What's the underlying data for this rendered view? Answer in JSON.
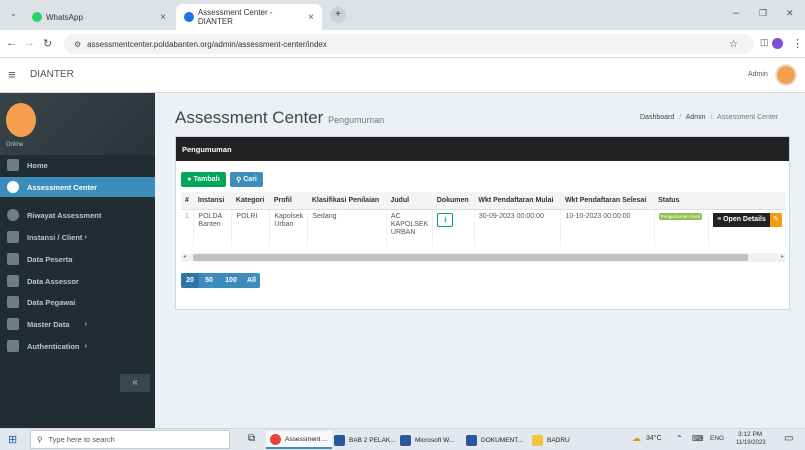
{
  "browser": {
    "tabs": [
      {
        "label": "WhatsApp",
        "active": false
      },
      {
        "label": "Assessment Center - DIANTER",
        "active": true
      }
    ],
    "new_tab": "+",
    "url_scheme_icon": "site-info-icon",
    "url": "assessmentcenter.poldabanten.org/admin/assessment-center/index",
    "window_controls": {
      "minimize": "–",
      "maximize": "❐",
      "close": "✕"
    }
  },
  "header": {
    "brand": "DIANTER",
    "user": "Admin"
  },
  "sidebar": {
    "status": "Online",
    "collapse_icon": "«",
    "items": [
      {
        "label": "Home",
        "icon": "home-icon",
        "active": false,
        "has_children": false
      },
      {
        "label": "Assessment Center",
        "icon": "check-circle-icon",
        "active": true,
        "has_children": false
      },
      {
        "label": "Riwayat Assessment",
        "icon": "history-icon",
        "active": false,
        "has_children": false
      },
      {
        "label": "Instansi / Client",
        "icon": "building-icon",
        "active": false,
        "has_children": true
      },
      {
        "label": "Data Peserta",
        "icon": "users-icon",
        "active": false,
        "has_children": false
      },
      {
        "label": "Data Assessor",
        "icon": "user-icon",
        "active": false,
        "has_children": false
      },
      {
        "label": "Data Pegawai",
        "icon": "group-icon",
        "active": false,
        "has_children": false
      },
      {
        "label": "Master Data",
        "icon": "database-icon",
        "active": false,
        "has_children": true
      },
      {
        "label": "Authentication",
        "icon": "key-icon",
        "active": false,
        "has_children": true
      }
    ]
  },
  "page": {
    "title": "Assessment Center",
    "subtitle": "Pengumuman",
    "breadcrumb": [
      "Dashboard",
      "Admin",
      "Assessment Center"
    ],
    "box_title": "Pengumuman",
    "buttons": {
      "add": "Tambah",
      "search": "Cari"
    },
    "table": {
      "columns": [
        "#",
        "Instansi",
        "Kategori",
        "Profil",
        "Klasifikasi Penilaian",
        "Judul",
        "Dokumen",
        "Wkt Pendaftaran Mulai",
        "Wkt Pendaftaran Selesai",
        "Status",
        ""
      ],
      "rows": [
        {
          "no": "1",
          "instansi": "POLDA Banten",
          "kategori": "POLRI",
          "profil": "Kapolsek Urban",
          "klasifikasi": "Sedang",
          "judul": "AC KAPOLSEK URBAN",
          "mulai": "30-09-2023 00:00:00",
          "selesai": "10-10-2023 00:00:00",
          "status": "Pengumuman Hasil",
          "action": "Open Details"
        }
      ]
    },
    "page_sizes": [
      "20",
      "50",
      "100",
      "All"
    ]
  },
  "taskbar": {
    "search_placeholder": "Type here to search",
    "apps": [
      {
        "label": "Assessment ...",
        "color": "#e8453c"
      },
      {
        "label": "BAB 2 PELAK...",
        "color": "#2b579a"
      },
      {
        "label": "Microsoft W...",
        "color": "#2b579a"
      },
      {
        "label": "DOKUMENT...",
        "color": "#2b579a"
      },
      {
        "label": "BADRU",
        "color": "#f0c43c"
      }
    ],
    "weather": "34°C",
    "lang": "ENG",
    "time": "3:12 PM",
    "date": "11/19/2023"
  },
  "colors": {
    "sidebar_bg": "#222d32",
    "accent_blue": "#3c8dbc",
    "green": "#00a65a",
    "status_green": "#8cc152",
    "orange": "#f39c12",
    "dark": "#222222"
  }
}
